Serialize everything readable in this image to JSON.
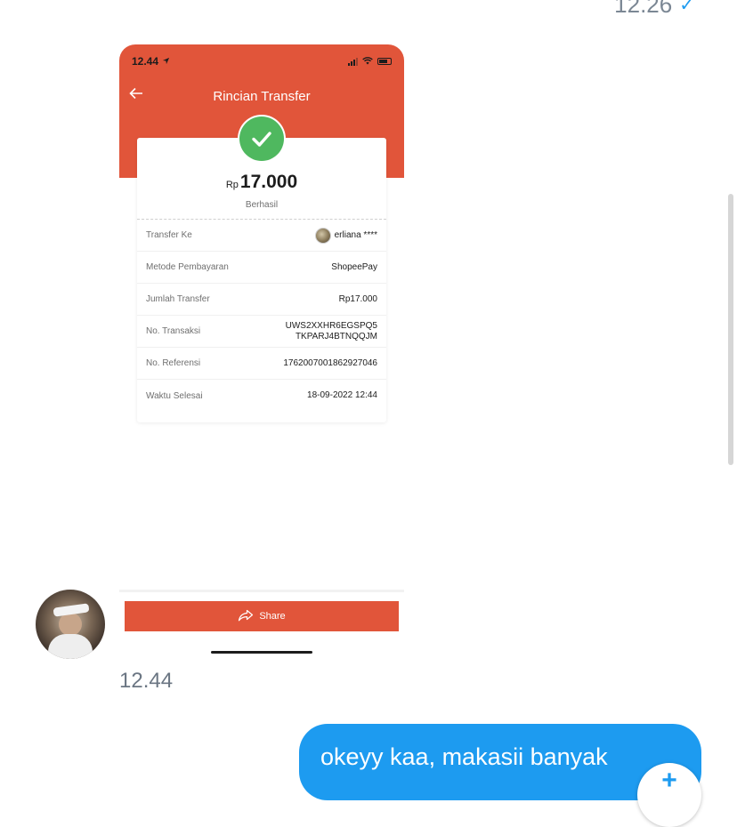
{
  "chat": {
    "top_timestamp": "12.26",
    "bottom_timestamp": "12.44",
    "outgoing_message": "okeyy kaa, makasii banyak",
    "accent_color": "#1d9bf0"
  },
  "attachment": {
    "status_bar": {
      "time": "12.44"
    },
    "header": {
      "title": "Rincian Transfer",
      "color": "#e1553a"
    },
    "receipt": {
      "currency": "Rp",
      "amount": "17.000",
      "status": "Berhasil",
      "rows": [
        {
          "label": "Transfer Ke",
          "value": "erliana ****"
        },
        {
          "label": "Metode Pembayaran",
          "value": "ShopeePay"
        },
        {
          "label": "Jumlah Transfer",
          "value": "Rp17.000"
        },
        {
          "label": "No. Transaksi",
          "value_line1": "UWS2XXHR6EGSPQ5",
          "value_line2": "TKPARJ4BTNQQJM"
        },
        {
          "label": "No. Referensi",
          "value": "1762007001862927046"
        },
        {
          "label": "Waktu Selesai",
          "value": "18-09-2022 12:44"
        }
      ]
    },
    "share_button": {
      "label": "Share"
    }
  }
}
